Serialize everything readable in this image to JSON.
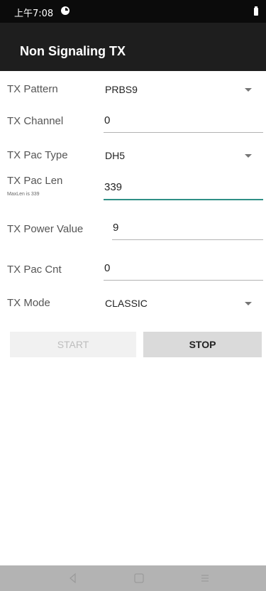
{
  "status_bar": {
    "time": "上午7:08"
  },
  "app_bar": {
    "title": "Non Signaling TX"
  },
  "form": {
    "tx_pattern": {
      "label": "TX Pattern",
      "value": "PRBS9"
    },
    "tx_channel": {
      "label": "TX Channel",
      "value": "0"
    },
    "tx_pac_type": {
      "label": "TX Pac Type",
      "value": "DH5"
    },
    "tx_pac_len": {
      "label": "TX Pac Len",
      "sublabel": "MaxLen is 339",
      "value": "339"
    },
    "tx_power_value": {
      "label": "TX Power Value",
      "value": "9"
    },
    "tx_pac_cnt": {
      "label": "TX Pac Cnt",
      "value": "0"
    },
    "tx_mode": {
      "label": "TX Mode",
      "value": "CLASSIC"
    }
  },
  "actions": {
    "start_label": "START",
    "stop_label": "STOP"
  },
  "nav_bar": {
    "icons": [
      "back-icon",
      "home-icon",
      "recents-icon"
    ]
  },
  "colors": {
    "status_bar": "#0b0b0b",
    "app_bar": "#1e1e1e",
    "focus_accent": "#2f8f86",
    "nav_bar": "#b3b3b3"
  }
}
